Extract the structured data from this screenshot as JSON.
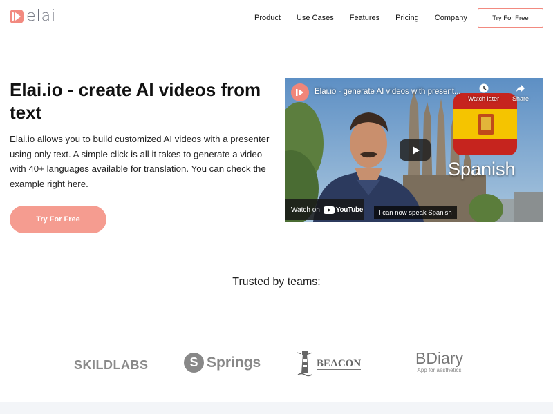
{
  "brand": {
    "logo_text": "elai",
    "accent_color": "#f28a80"
  },
  "nav": {
    "items": [
      "Product",
      "Use Cases",
      "Features",
      "Pricing",
      "Company"
    ],
    "cta_label": "Try For Free"
  },
  "hero": {
    "title": "Elai.io - create AI videos from text",
    "description": "Elai.io allows you to build customized AI videos with a presenter using only text. A simple click is all it takes to generate a video with 40+ languages available for translation. You can check the example right here.",
    "cta_label": "Try For Free"
  },
  "video": {
    "title": "Elai.io - generate AI videos with present...",
    "watch_later_label": "Watch later",
    "share_label": "Share",
    "overlay_text": "Spanish",
    "watch_on_label": "Watch on",
    "youtube_label": "YouTube",
    "caption": "I can now speak Spanish"
  },
  "trusted": {
    "title": "Trusted by teams:",
    "logos": {
      "skildlabs": "SKILDLABS",
      "springs": "Springs",
      "springs_mark": "S",
      "beacon": "BEACON",
      "bdiary": "BDiary",
      "bdiary_sub": "App for aesthetics"
    }
  }
}
